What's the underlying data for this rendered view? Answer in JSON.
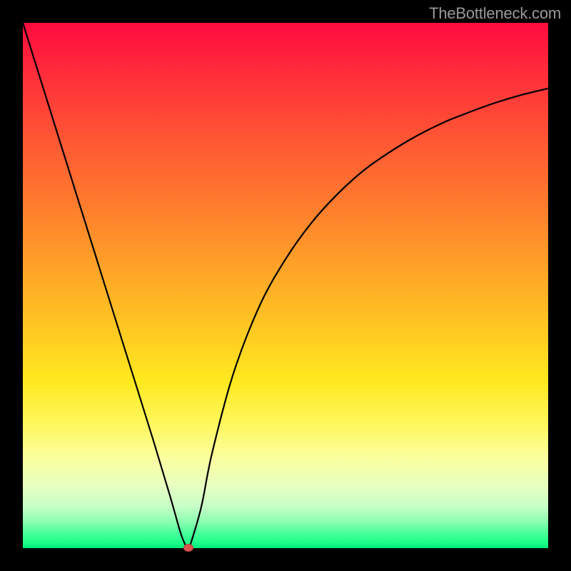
{
  "watermark": "TheBottleneck.com",
  "chart_data": {
    "type": "line",
    "title": "",
    "xlabel": "",
    "ylabel": "",
    "xlim": [
      0,
      100
    ],
    "ylim": [
      0,
      100
    ],
    "grid": false,
    "x": [
      0,
      5,
      10,
      15,
      20,
      25,
      28,
      30,
      31,
      31.5,
      32,
      34,
      36,
      40,
      45,
      50,
      55,
      60,
      65,
      70,
      75,
      80,
      85,
      90,
      95,
      100
    ],
    "values": [
      100,
      84,
      68,
      52,
      36,
      20,
      10,
      3,
      0.5,
      0,
      1,
      8,
      18,
      33,
      46,
      55,
      62,
      67.5,
      72,
      75.5,
      78.5,
      81,
      83,
      84.8,
      86.3,
      87.5
    ],
    "minimum_marker": {
      "x": 31.5,
      "y": 0
    },
    "gradient_stops": [
      {
        "pos": 0,
        "color": "#ff0b3f"
      },
      {
        "pos": 10,
        "color": "#ff2e3a"
      },
      {
        "pos": 22,
        "color": "#ff5634"
      },
      {
        "pos": 34,
        "color": "#ff7a2e"
      },
      {
        "pos": 46,
        "color": "#ffa128"
      },
      {
        "pos": 58,
        "color": "#ffc722"
      },
      {
        "pos": 68,
        "color": "#ffe81e"
      },
      {
        "pos": 76,
        "color": "#fff75a"
      },
      {
        "pos": 83,
        "color": "#faffa0"
      },
      {
        "pos": 88,
        "color": "#e8ffc0"
      },
      {
        "pos": 92,
        "color": "#c8ffc8"
      },
      {
        "pos": 95,
        "color": "#8cffb0"
      },
      {
        "pos": 97,
        "color": "#4cff9a"
      },
      {
        "pos": 99,
        "color": "#1cff8a"
      },
      {
        "pos": 100,
        "color": "#00e878"
      }
    ]
  }
}
